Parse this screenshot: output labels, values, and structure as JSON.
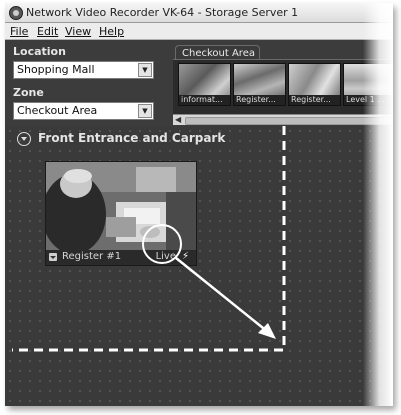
{
  "window": {
    "title": "Network Video Recorder VK-64 - Storage Server 1"
  },
  "menu": [
    "File",
    "Edit",
    "View",
    "Help"
  ],
  "location": {
    "label": "Location",
    "value": "Shopping Mall"
  },
  "zone": {
    "label": "Zone",
    "value": "Checkout Area"
  },
  "strip": {
    "tab_label": "Checkout Area",
    "thumbnails": [
      "informat...",
      "Register...",
      "Register...",
      "Level 1 ..."
    ]
  },
  "section": {
    "title": "Front Entrance and Carpark"
  },
  "camera": {
    "name": "Register #1",
    "status": "Live"
  }
}
